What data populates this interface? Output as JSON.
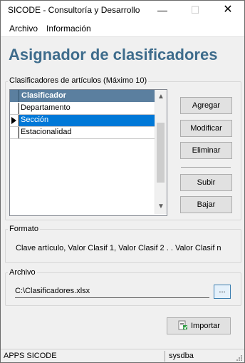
{
  "window": {
    "title": "SICODE - Consultoría y Desarrollo",
    "minimize_glyph": "—",
    "maximize_glyph": "☐",
    "close_glyph": "✕"
  },
  "menu": [
    "Archivo",
    "Información"
  ],
  "header": {
    "title": "Asignador de clasificadores"
  },
  "classifiers": {
    "group_label": "Clasificadores de artículos (Máximo 10)",
    "column_header": "Clasificador",
    "rows": [
      {
        "label": "Departamento",
        "selected": false
      },
      {
        "label": "Sección",
        "selected": true
      },
      {
        "label": "Estacionalidad",
        "selected": false
      }
    ],
    "buttons": {
      "add": "Agregar",
      "modify": "Modificar",
      "delete": "Eliminar",
      "up": "Subir",
      "down": "Bajar"
    }
  },
  "format": {
    "group_label": "Formato",
    "text": "Clave  artículo, Valor Clasif 1, Valor Clasif 2 . . Valor Clasif n"
  },
  "file": {
    "group_label": "Archivo",
    "path": "C:\\Clasificadores.xlsx",
    "browse_label": "..."
  },
  "import_button": {
    "label": "Importar"
  },
  "status": {
    "left": "APPS SICODE",
    "right": "sysdba"
  },
  "colors": {
    "title_blue": "#3e6c8c",
    "grid_header": "#5b7f9f",
    "selection": "#0078d7"
  },
  "icons": {
    "import": "import-icon",
    "pointer": "row-pointer-icon"
  }
}
